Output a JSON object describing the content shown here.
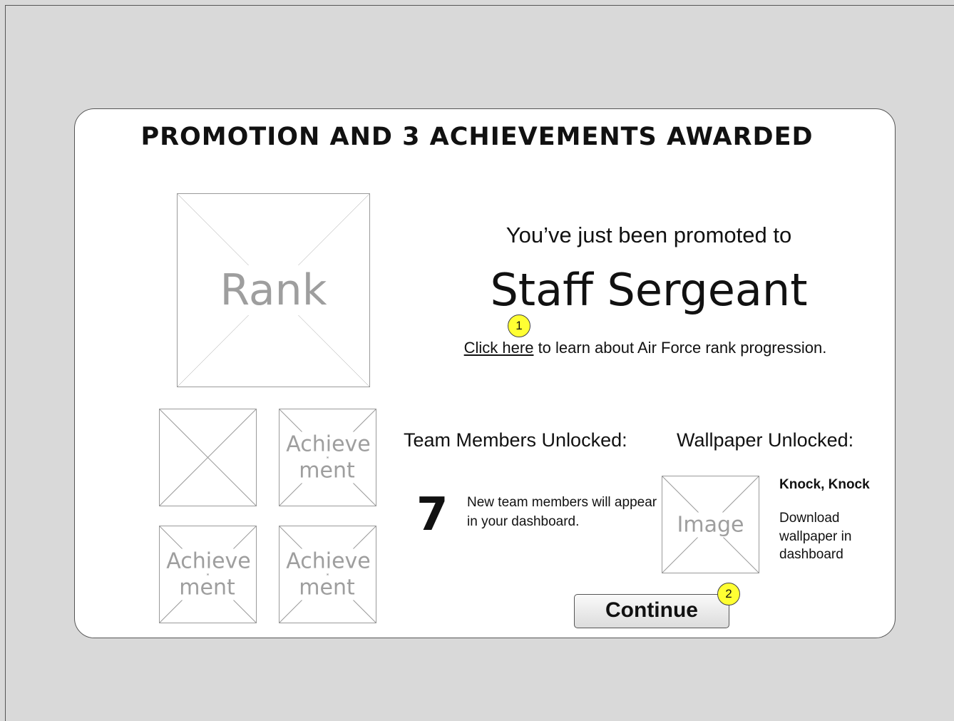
{
  "dialog": {
    "title": "PROMOTION AND 3 ACHIEVEMENTS AWARDED",
    "rank_placeholder": "Rank",
    "achievements": [
      "",
      "Achievement",
      "Achievement",
      "Achievement"
    ],
    "promoted_text": "You’ve just been promoted to",
    "rank_name": "Staff Sergeant",
    "learn_link": "Click here",
    "learn_text": " to learn about Air Force rank progression.",
    "team": {
      "label": "Team Members Unlocked:",
      "count": "7",
      "description": "New team members will appear in your dashboard."
    },
    "wallpaper": {
      "label": "Wallpaper Unlocked:",
      "image_placeholder": "Image",
      "name": "Knock, Knock",
      "description": "Download wallpaper in dashboard"
    },
    "continue_label": "Continue"
  },
  "annotations": [
    "1",
    "2"
  ],
  "colors": {
    "background": "#d9d9d9",
    "marker": "#ffff33",
    "placeholder_stroke": "#9a9a9a"
  }
}
